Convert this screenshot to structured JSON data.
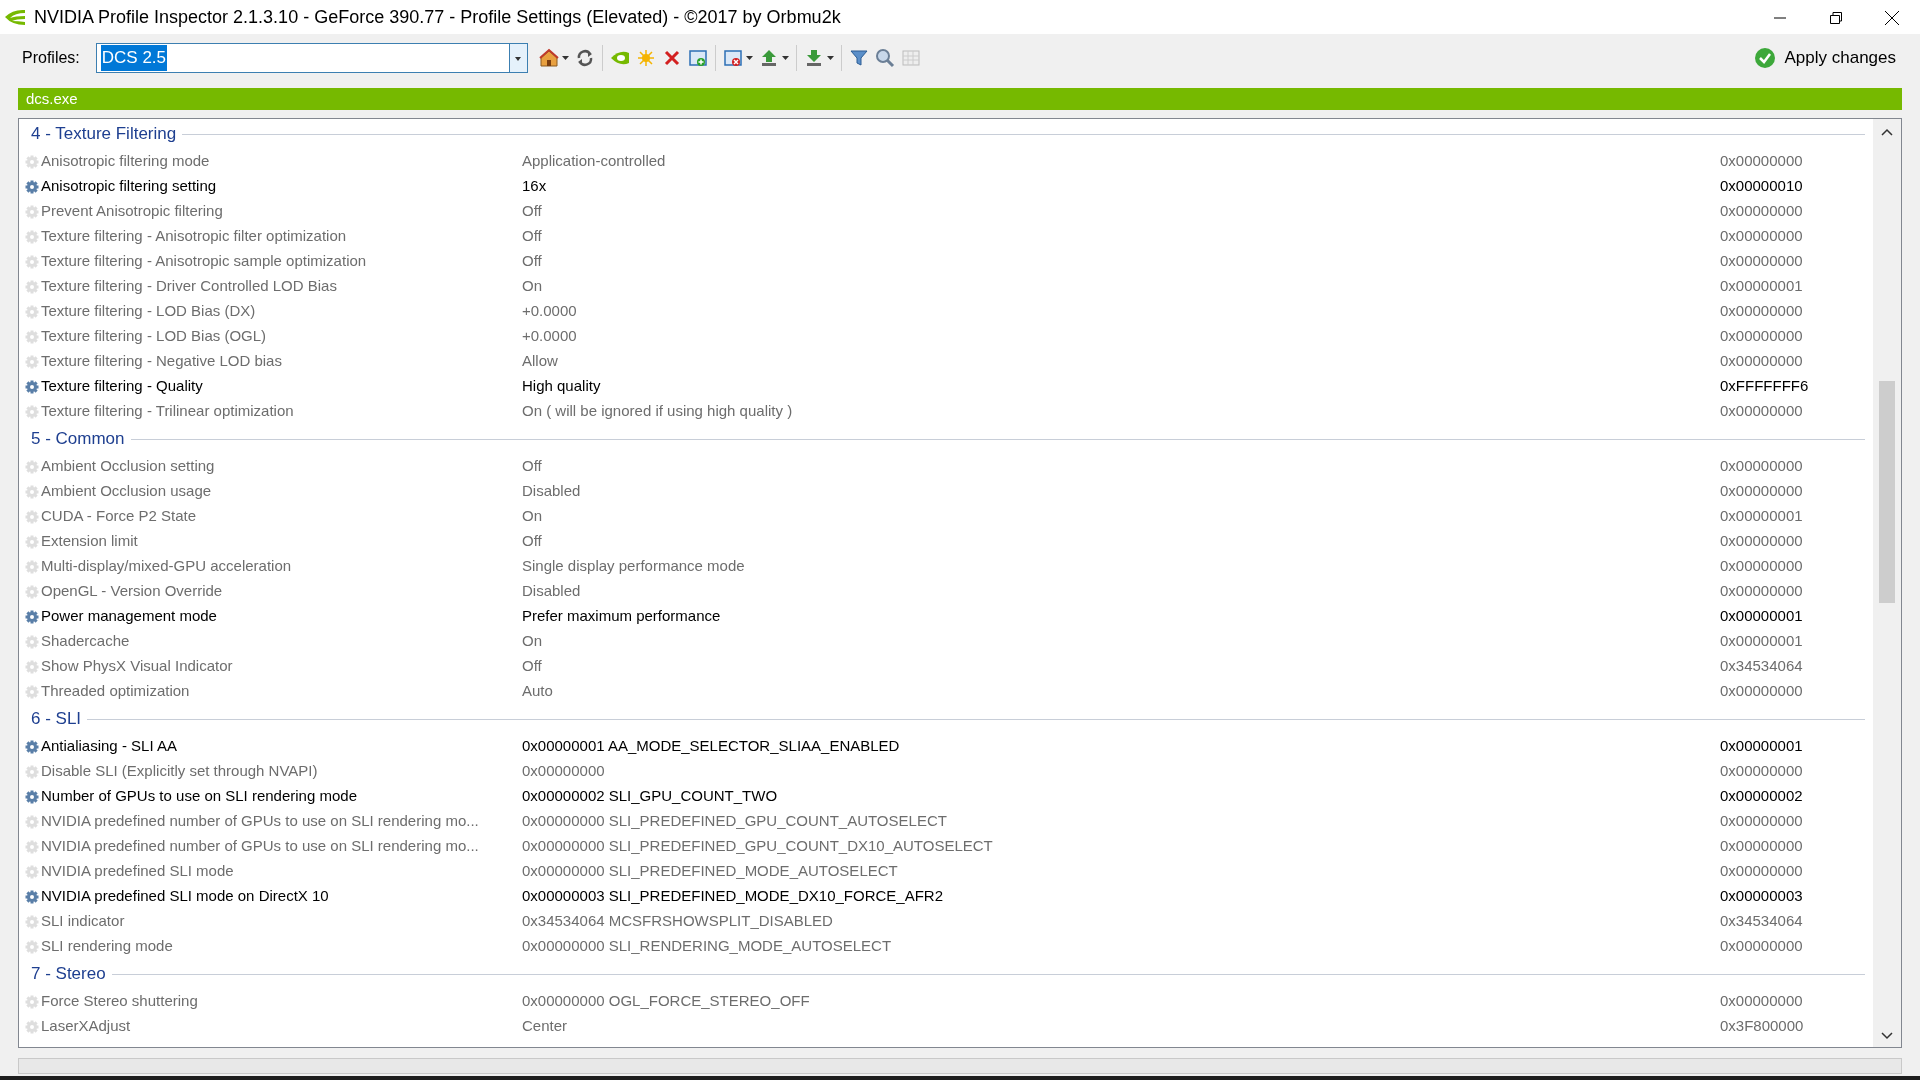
{
  "window": {
    "title": "NVIDIA Profile Inspector 2.1.3.10 - GeForce 390.77 - Profile Settings (Elevated) - ©2017 by Orbmu2k"
  },
  "toolbar": {
    "profiles_label": "Profiles:",
    "profile_value": "DCS 2.5",
    "apply_button": "Apply changes"
  },
  "application_bar": {
    "text": "dcs.exe"
  },
  "groups": [
    {
      "title": "4 - Texture Filtering",
      "settings": [
        {
          "name": "Anisotropic filtering mode",
          "value": "Application-controlled",
          "hex": "0x00000000",
          "modified": false
        },
        {
          "name": "Anisotropic filtering setting",
          "value": "16x",
          "hex": "0x00000010",
          "modified": true
        },
        {
          "name": "Prevent Anisotropic filtering",
          "value": "Off",
          "hex": "0x00000000",
          "modified": false
        },
        {
          "name": "Texture filtering - Anisotropic filter optimization",
          "value": "Off",
          "hex": "0x00000000",
          "modified": false
        },
        {
          "name": "Texture filtering - Anisotropic sample optimization",
          "value": "Off",
          "hex": "0x00000000",
          "modified": false
        },
        {
          "name": "Texture filtering - Driver Controlled LOD Bias",
          "value": "On",
          "hex": "0x00000001",
          "modified": false
        },
        {
          "name": "Texture filtering - LOD Bias (DX)",
          "value": "+0.0000",
          "hex": "0x00000000",
          "modified": false
        },
        {
          "name": "Texture filtering - LOD Bias (OGL)",
          "value": "+0.0000",
          "hex": "0x00000000",
          "modified": false
        },
        {
          "name": "Texture filtering - Negative LOD bias",
          "value": "Allow",
          "hex": "0x00000000",
          "modified": false
        },
        {
          "name": "Texture filtering - Quality",
          "value": "High quality",
          "hex": "0xFFFFFFF6",
          "modified": true
        },
        {
          "name": "Texture filtering - Trilinear optimization",
          "value": "On ( will be ignored if using high quality )",
          "hex": "0x00000000",
          "modified": false
        }
      ]
    },
    {
      "title": "5 - Common",
      "settings": [
        {
          "name": "Ambient Occlusion setting",
          "value": "Off",
          "hex": "0x00000000",
          "modified": false
        },
        {
          "name": "Ambient Occlusion usage",
          "value": "Disabled",
          "hex": "0x00000000",
          "modified": false
        },
        {
          "name": "CUDA - Force P2 State",
          "value": "On",
          "hex": "0x00000001",
          "modified": false
        },
        {
          "name": "Extension limit",
          "value": "Off",
          "hex": "0x00000000",
          "modified": false
        },
        {
          "name": "Multi-display/mixed-GPU acceleration",
          "value": "Single display performance mode",
          "hex": "0x00000000",
          "modified": false
        },
        {
          "name": "OpenGL - Version Override",
          "value": "Disabled",
          "hex": "0x00000000",
          "modified": false
        },
        {
          "name": "Power management mode",
          "value": "Prefer maximum performance",
          "hex": "0x00000001",
          "modified": true
        },
        {
          "name": "Shadercache",
          "value": "On",
          "hex": "0x00000001",
          "modified": false
        },
        {
          "name": "Show PhysX Visual Indicator",
          "value": "Off",
          "hex": "0x34534064",
          "modified": false
        },
        {
          "name": "Threaded optimization",
          "value": "Auto",
          "hex": "0x00000000",
          "modified": false
        }
      ]
    },
    {
      "title": "6 - SLI",
      "settings": [
        {
          "name": "Antialiasing - SLI AA",
          "value": "0x00000001 AA_MODE_SELECTOR_SLIAA_ENABLED",
          "hex": "0x00000001",
          "modified": true
        },
        {
          "name": "Disable SLI (Explicitly set through NVAPI)",
          "value": "0x00000000",
          "hex": "0x00000000",
          "modified": false
        },
        {
          "name": "Number of GPUs to use on SLI rendering mode",
          "value": "0x00000002 SLI_GPU_COUNT_TWO",
          "hex": "0x00000002",
          "modified": true
        },
        {
          "name": "NVIDIA predefined number of GPUs to use on SLI rendering mo...",
          "value": "0x00000000 SLI_PREDEFINED_GPU_COUNT_AUTOSELECT",
          "hex": "0x00000000",
          "modified": false
        },
        {
          "name": "NVIDIA predefined number of GPUs to use on SLI rendering mo...",
          "value": "0x00000000 SLI_PREDEFINED_GPU_COUNT_DX10_AUTOSELECT",
          "hex": "0x00000000",
          "modified": false
        },
        {
          "name": "NVIDIA predefined SLI mode",
          "value": "0x00000000 SLI_PREDEFINED_MODE_AUTOSELECT",
          "hex": "0x00000000",
          "modified": false
        },
        {
          "name": "NVIDIA predefined SLI mode on DirectX 10",
          "value": "0x00000003 SLI_PREDEFINED_MODE_DX10_FORCE_AFR2",
          "hex": "0x00000003",
          "modified": true
        },
        {
          "name": "SLI indicator",
          "value": "0x34534064 MCSFRSHOWSPLIT_DISABLED",
          "hex": "0x34534064",
          "modified": false
        },
        {
          "name": "SLI rendering mode",
          "value": "0x00000000 SLI_RENDERING_MODE_AUTOSELECT",
          "hex": "0x00000000",
          "modified": false
        }
      ]
    },
    {
      "title": "7 - Stereo",
      "settings": [
        {
          "name": "Force Stereo shuttering",
          "value": "0x00000000 OGL_FORCE_STEREO_OFF",
          "hex": "0x00000000",
          "modified": false
        },
        {
          "name": "LaserXAdjust",
          "value": "Center",
          "hex": "0x3F800000",
          "modified": false
        }
      ]
    }
  ]
}
